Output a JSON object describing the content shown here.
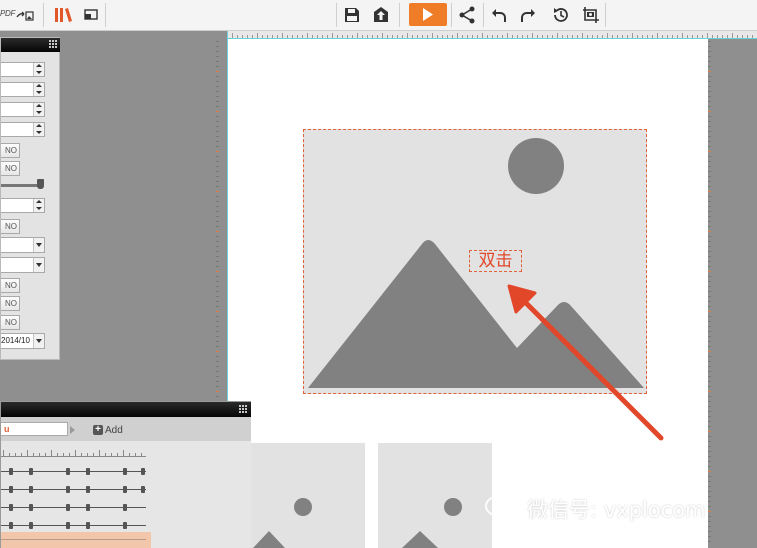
{
  "toolbar": {
    "pdf_label": "PDF",
    "icons": [
      "pdf-export-icon",
      "image-export-icon",
      "library-icon",
      "screen-icon",
      "save-icon",
      "publish-icon",
      "play-icon",
      "share-icon",
      "undo-icon",
      "redo-icon",
      "history-icon",
      "screenshot-icon"
    ],
    "accent_color": "#ef7d27"
  },
  "canvas": {
    "double_click_label": "双击",
    "placeholder_icon": "image-placeholder-icon",
    "selection_color": "#e0623a"
  },
  "properties_panel": {
    "no_buttons": [
      "NO",
      "NO",
      "NO",
      "NO",
      "NO",
      "NO"
    ],
    "date_value": "2014/10"
  },
  "timeline": {
    "name_value": "u",
    "add_label": "Add"
  },
  "watermark": {
    "text": "微信号: vxplocom",
    "icon": "wechat-icon"
  }
}
